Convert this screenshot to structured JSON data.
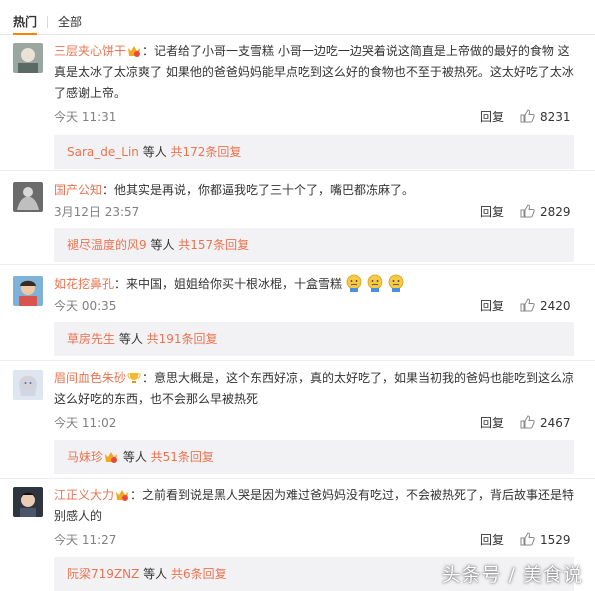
{
  "tabs": {
    "active": "热门",
    "other": "全部"
  },
  "comments": [
    {
      "user": "三层夹心饼干",
      "text": "：记者给了小哥一支雪糕 小哥一边吃一边哭着说这简直是上帝做的最好的食物 这真是太冰了太凉爽了 如果他的爸爸妈妈能早点吃到这么好的食物也不至于被热死。这太好吃了太冰了感谢上帝。",
      "time": "今天 11:31",
      "reply_label": "回复",
      "likes": "8231",
      "replies": {
        "user": "Sara_de_Lin",
        "middle": " 等人 ",
        "link": "共172条回复"
      }
    },
    {
      "user": "国产公知",
      "text": "：他其实是再说，你都逼我吃了三十个了，嘴巴都冻麻了。",
      "time": "3月12日 23:57",
      "reply_label": "回复",
      "likes": "2829",
      "replies": {
        "user": "褪尽温度的风9",
        "middle": " 等人 ",
        "link": "共157条回复"
      }
    },
    {
      "user": "如花挖鼻孔",
      "text": "：来中国，姐姐给你买十根冰棍，十盒雪糕",
      "time": "今天 00:35",
      "reply_label": "回复",
      "likes": "2420",
      "replies": {
        "user": "草房先生",
        "middle": " 等人 ",
        "link": "共191条回复"
      }
    },
    {
      "user": "眉间血色朱砂",
      "text": "：意思大概是，这个东西好凉，真的太好吃了，如果当初我的爸妈也能吃到这么凉这么好吃的东西，也不会那么早被热死",
      "time": "今天 11:02",
      "reply_label": "回复",
      "likes": "2467",
      "replies": {
        "user": "马妹珍",
        "middle": " 等人 ",
        "link": "共51条回复"
      }
    },
    {
      "user": "江正义大力",
      "text": "：之前看到说是黑人哭是因为难过爸妈妈没有吃过，不会被热死了，背后故事还是特别感人的",
      "time": "今天 11:27",
      "reply_label": "回复",
      "likes": "1529",
      "replies": {
        "user": "阮梁719ZNZ",
        "middle": " 等人 ",
        "link": "共6条回复"
      }
    }
  ],
  "watermark": "头条号 / 美食说",
  "colors": {
    "username": "#eb7350",
    "tab_underline": "#ff8200",
    "reply_box_bg": "#f2f2f5",
    "meta_gray": "#808080"
  }
}
